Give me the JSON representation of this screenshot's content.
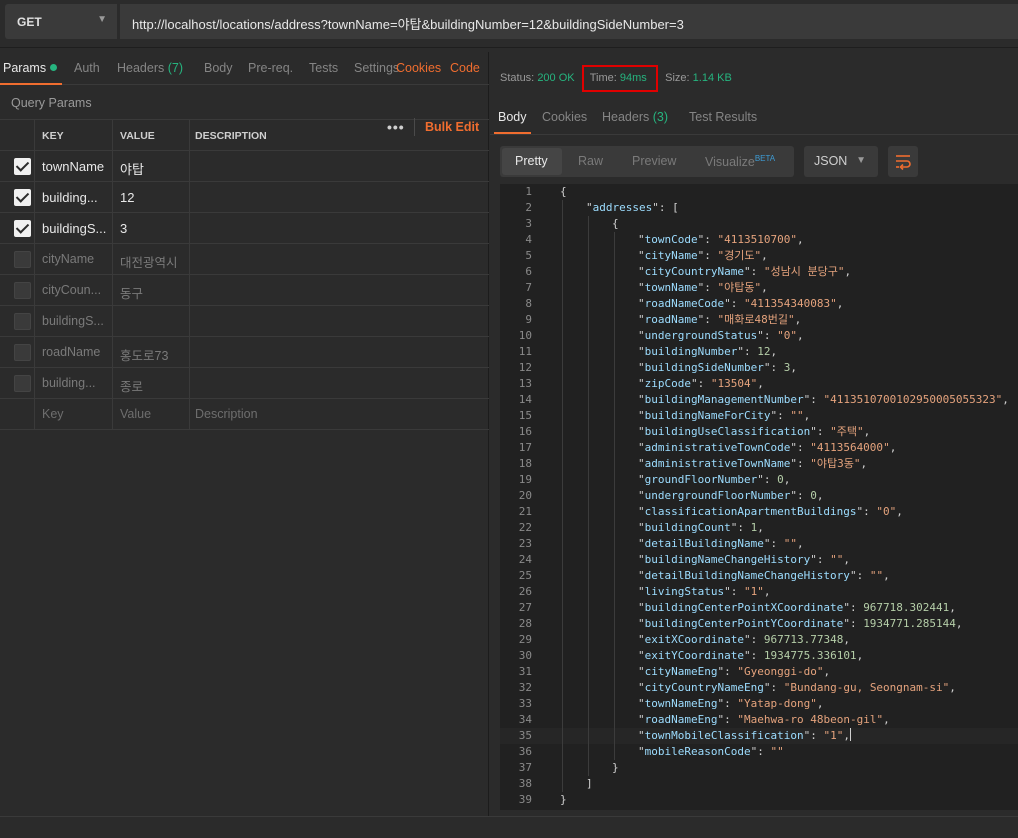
{
  "request": {
    "method": "GET",
    "url": "http://localhost/locations/address?townName=야탑&buildingNumber=12&buildingSideNumber=3"
  },
  "req_tabs": {
    "params": "Params",
    "auth": "Auth",
    "headers": "Headers",
    "headers_count": "(7)",
    "body": "Body",
    "prereq": "Pre-req.",
    "tests": "Tests",
    "settings": "Settings",
    "cookies": "Cookies",
    "code": "Code"
  },
  "query_params": {
    "title": "Query Params",
    "col_key": "KEY",
    "col_value": "VALUE",
    "col_desc": "DESCRIPTION",
    "more": "•••",
    "bulk_edit": "Bulk Edit",
    "rows": [
      {
        "key": "townName",
        "value": "야탑",
        "checked": true
      },
      {
        "key": "building...",
        "value": "12",
        "checked": true
      },
      {
        "key": "buildingS...",
        "value": "3",
        "checked": true
      },
      {
        "key": "cityName",
        "value": "대전광역시",
        "checked": false
      },
      {
        "key": "cityCoun...",
        "value": "동구",
        "checked": false
      },
      {
        "key": "buildingS...",
        "value": "",
        "checked": false
      },
      {
        "key": "roadName",
        "value": "홍도로73",
        "checked": false
      },
      {
        "key": "building...",
        "value": "종로",
        "checked": false
      }
    ],
    "placeholder": {
      "key": "Key",
      "value": "Value",
      "desc": "Description"
    }
  },
  "response": {
    "status_label": "Status:",
    "status_value": "200 OK",
    "time_label": "Time:",
    "time_value": "94ms",
    "size_label": "Size:",
    "size_value": "1.14 KB",
    "tabs": {
      "body": "Body",
      "cookies": "Cookies",
      "headers": "Headers",
      "headers_count": "(3)",
      "test_results": "Test Results"
    },
    "view": {
      "pretty": "Pretty",
      "raw": "Raw",
      "preview": "Preview",
      "visualize": "Visualize",
      "beta": "BETA",
      "format": "JSON"
    },
    "current_line": 35,
    "body_lines": [
      {
        "indent": 0,
        "t": "{"
      },
      {
        "indent": 1,
        "k": "addresses",
        "t": "["
      },
      {
        "indent": 2,
        "t": "{"
      },
      {
        "indent": 3,
        "k": "townCode",
        "s": "4113510700"
      },
      {
        "indent": 3,
        "k": "cityName",
        "s": "경기도"
      },
      {
        "indent": 3,
        "k": "cityCountryName",
        "s": "성남시 분당구"
      },
      {
        "indent": 3,
        "k": "townName",
        "s": "야탑동"
      },
      {
        "indent": 3,
        "k": "roadNameCode",
        "s": "411354340083"
      },
      {
        "indent": 3,
        "k": "roadName",
        "s": "매화로48번길"
      },
      {
        "indent": 3,
        "k": "undergroundStatus",
        "s": "0"
      },
      {
        "indent": 3,
        "k": "buildingNumber",
        "n": "12"
      },
      {
        "indent": 3,
        "k": "buildingSideNumber",
        "n": "3"
      },
      {
        "indent": 3,
        "k": "zipCode",
        "s": "13504"
      },
      {
        "indent": 3,
        "k": "buildingManagementNumber",
        "s": "4113510700102950005055323"
      },
      {
        "indent": 3,
        "k": "buildingNameForCity",
        "s": ""
      },
      {
        "indent": 3,
        "k": "buildingUseClassification",
        "s": "주택"
      },
      {
        "indent": 3,
        "k": "administrativeTownCode",
        "s": "4113564000"
      },
      {
        "indent": 3,
        "k": "administrativeTownName",
        "s": "야탑3동"
      },
      {
        "indent": 3,
        "k": "groundFloorNumber",
        "n": "0"
      },
      {
        "indent": 3,
        "k": "undergroundFloorNumber",
        "n": "0"
      },
      {
        "indent": 3,
        "k": "classificationApartmentBuildings",
        "s": "0"
      },
      {
        "indent": 3,
        "k": "buildingCount",
        "n": "1"
      },
      {
        "indent": 3,
        "k": "detailBuildingName",
        "s": ""
      },
      {
        "indent": 3,
        "k": "buildingNameChangeHistory",
        "s": ""
      },
      {
        "indent": 3,
        "k": "detailBuildingNameChangeHistory",
        "s": ""
      },
      {
        "indent": 3,
        "k": "livingStatus",
        "s": "1"
      },
      {
        "indent": 3,
        "k": "buildingCenterPointXCoordinate",
        "n": "967718.302441"
      },
      {
        "indent": 3,
        "k": "buildingCenterPointYCoordinate",
        "n": "1934771.285144"
      },
      {
        "indent": 3,
        "k": "exitXCoordinate",
        "n": "967713.77348"
      },
      {
        "indent": 3,
        "k": "exitYCoordinate",
        "n": "1934775.336101"
      },
      {
        "indent": 3,
        "k": "cityNameEng",
        "s": "Gyeonggi-do"
      },
      {
        "indent": 3,
        "k": "cityCountryNameEng",
        "s": "Bundang-gu, Seongnam-si"
      },
      {
        "indent": 3,
        "k": "townNameEng",
        "s": "Yatap-dong"
      },
      {
        "indent": 3,
        "k": "roadNameEng",
        "s": "Maehwa-ro 48beon-gil"
      },
      {
        "indent": 3,
        "k": "townMobileClassification",
        "s": "1"
      },
      {
        "indent": 3,
        "k": "mobileReasonCode",
        "s": "",
        "last": true
      },
      {
        "indent": 2,
        "t": "}"
      },
      {
        "indent": 1,
        "t": "]"
      },
      {
        "indent": 0,
        "t": "}"
      }
    ]
  },
  "colors": {
    "accent": "#f06d2f",
    "status_green": "#26b47f",
    "highlight_box": "#e00000"
  }
}
